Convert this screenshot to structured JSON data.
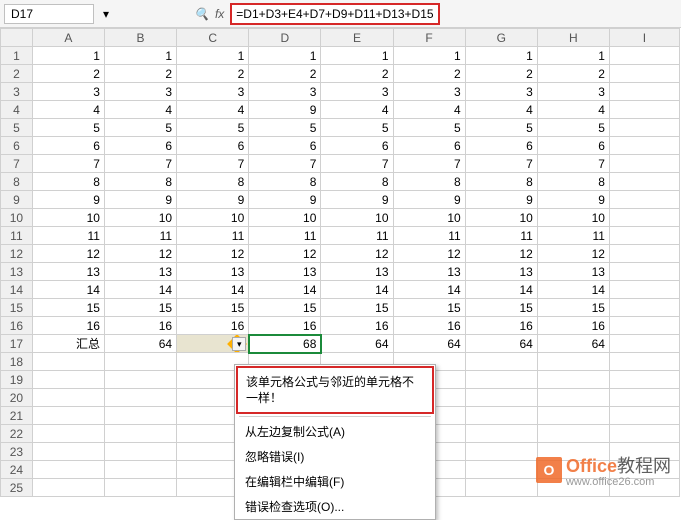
{
  "topbar": {
    "cell_ref": "D17",
    "fx_label": "fx",
    "formula": "=D1+D3+E4+D7+D9+D11+D13+D15"
  },
  "columns": [
    "A",
    "B",
    "C",
    "D",
    "E",
    "F",
    "G",
    "H",
    "I"
  ],
  "row_headers": [
    "1",
    "2",
    "3",
    "4",
    "5",
    "6",
    "7",
    "8",
    "9",
    "10",
    "11",
    "12",
    "13",
    "14",
    "15",
    "16",
    "17",
    "18",
    "19",
    "20",
    "21",
    "22",
    "23",
    "24",
    "25"
  ],
  "label_cell": {
    "row": 17,
    "text": "汇总"
  },
  "active_cell": {
    "row": 17,
    "col": "D",
    "value": "68"
  },
  "data_rows": [
    {
      "A": "1",
      "B": "1",
      "C": "1",
      "D": "1",
      "E": "1",
      "F": "1",
      "G": "1",
      "H": "1"
    },
    {
      "A": "2",
      "B": "2",
      "C": "2",
      "D": "2",
      "E": "2",
      "F": "2",
      "G": "2",
      "H": "2"
    },
    {
      "A": "3",
      "B": "3",
      "C": "3",
      "D": "3",
      "E": "3",
      "F": "3",
      "G": "3",
      "H": "3"
    },
    {
      "A": "4",
      "B": "4",
      "C": "4",
      "D": "9",
      "E": "4",
      "F": "4",
      "G": "4",
      "H": "4"
    },
    {
      "A": "5",
      "B": "5",
      "C": "5",
      "D": "5",
      "E": "5",
      "F": "5",
      "G": "5",
      "H": "5"
    },
    {
      "A": "6",
      "B": "6",
      "C": "6",
      "D": "6",
      "E": "6",
      "F": "6",
      "G": "6",
      "H": "6"
    },
    {
      "A": "7",
      "B": "7",
      "C": "7",
      "D": "7",
      "E": "7",
      "F": "7",
      "G": "7",
      "H": "7"
    },
    {
      "A": "8",
      "B": "8",
      "C": "8",
      "D": "8",
      "E": "8",
      "F": "8",
      "G": "8",
      "H": "8"
    },
    {
      "A": "9",
      "B": "9",
      "C": "9",
      "D": "9",
      "E": "9",
      "F": "9",
      "G": "9",
      "H": "9"
    },
    {
      "A": "10",
      "B": "10",
      "C": "10",
      "D": "10",
      "E": "10",
      "F": "10",
      "G": "10",
      "H": "10"
    },
    {
      "A": "11",
      "B": "11",
      "C": "11",
      "D": "11",
      "E": "11",
      "F": "11",
      "G": "11",
      "H": "11"
    },
    {
      "A": "12",
      "B": "12",
      "C": "12",
      "D": "12",
      "E": "12",
      "F": "12",
      "G": "12",
      "H": "12"
    },
    {
      "A": "13",
      "B": "13",
      "C": "13",
      "D": "13",
      "E": "13",
      "F": "13",
      "G": "13",
      "H": "13"
    },
    {
      "A": "14",
      "B": "14",
      "C": "14",
      "D": "14",
      "E": "14",
      "F": "14",
      "G": "14",
      "H": "14"
    },
    {
      "A": "15",
      "B": "15",
      "C": "15",
      "D": "15",
      "E": "15",
      "F": "15",
      "G": "15",
      "H": "15"
    },
    {
      "A": "16",
      "B": "16",
      "C": "16",
      "D": "16",
      "E": "16",
      "F": "16",
      "G": "16",
      "H": "16"
    }
  ],
  "sum_row": {
    "A": "汇总",
    "B": "64",
    "C": "",
    "D": "68",
    "E": "64",
    "F": "64",
    "G": "64",
    "H": "64"
  },
  "warning_text": "该单元格公式与邻近的单元格不一样！",
  "menu_items": [
    "从左边复制公式(A)",
    "忽略错误(I)",
    "在编辑栏中编辑(F)",
    "错误检查选项(O)..."
  ],
  "watermark": {
    "brand_bold": "Office",
    "brand_rest": "教程网",
    "sub": "www.office26.com"
  }
}
